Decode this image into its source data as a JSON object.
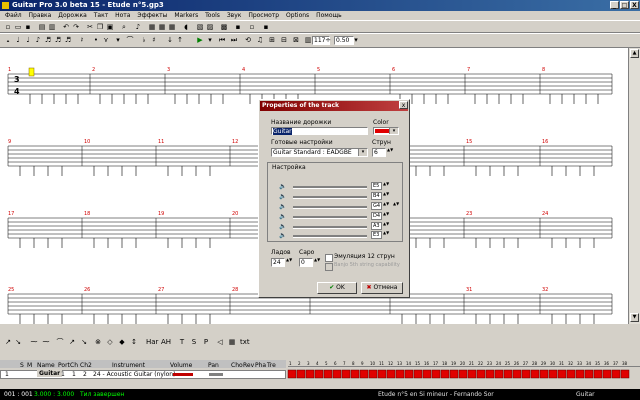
{
  "window": {
    "title": "Guitar Pro 3.0 beta 15 - Etude n°5.gp3",
    "min": "_",
    "max": "□",
    "close": "X"
  },
  "menu": [
    "Файл",
    "Правка",
    "Дорожка",
    "Такт",
    "Нота",
    "Эффекты",
    "Markers",
    "Tools",
    "Звук",
    "Просмотр",
    "Options",
    "Помощь"
  ],
  "toolbar": {
    "tempo_value": "117",
    "zoom_value": "0.50"
  },
  "score": {
    "time_sig_top": "3",
    "time_sig_bottom": "4",
    "row1_bars": [
      "1",
      "2",
      "3",
      "4",
      "5",
      "6",
      "7",
      "8"
    ],
    "row1_extra": [
      "",
      "",
      "",
      "",
      "",
      "",
      "",
      "",
      "",
      ""
    ],
    "row2_bars": [
      "9",
      "10",
      "11",
      "12",
      "13",
      "14",
      "15",
      "16"
    ],
    "row3_bars": [
      "17",
      "18",
      "19",
      "20",
      "21",
      "22",
      "23",
      "24"
    ],
    "row4_bars": [
      "25",
      "26",
      "27",
      "28",
      "29",
      "30",
      "31",
      "32"
    ],
    "right_bars": [
      "7",
      "8",
      "16",
      "24",
      "32"
    ]
  },
  "bottom_toolbar": {
    "labels": [
      "Har",
      "AH",
      "T",
      "S",
      "P"
    ],
    "txt": "txt"
  },
  "track_panel": {
    "headers": {
      "s": "S",
      "m": "M",
      "name": "Name",
      "port": "Port",
      "ch": "Ch",
      "ch2": "Ch2",
      "instrument": "Instrument",
      "volume": "Volume",
      "pan": "Pan",
      "cho": "Cho",
      "rev": "Rev",
      "pha": "Pha",
      "tre": "Tre"
    },
    "row": {
      "num": "1",
      "name": "Guitar",
      "port": "1",
      "ch": "1",
      "ch2": "2",
      "instrument": "24 - Acoustic Guitar (nylon)"
    },
    "bar_numbers": [
      "1",
      "2",
      "3",
      "4",
      "5",
      "6",
      "7",
      "8",
      "9",
      "10",
      "11",
      "12",
      "13",
      "14",
      "15",
      "16",
      "17",
      "18",
      "19",
      "20",
      "21",
      "22",
      "23",
      "24",
      "25",
      "26",
      "27",
      "28",
      "29",
      "30",
      "31",
      "32",
      "33",
      "34",
      "35",
      "36",
      "37",
      "38"
    ]
  },
  "status": {
    "pos": "001 : 001",
    "time": "3.000 : 3.000",
    "state": "Тил завершен",
    "song": "Etude n°5 en Si mineur - Fernando Sor",
    "track": "Guitar"
  },
  "dialog": {
    "title": "Properties of the track",
    "name_label": "Название дорожки",
    "name_value": "Guitar",
    "color_label": "Color",
    "preset_label": "Готовые настройки",
    "preset_value": "Guitar Standard : EADGBE",
    "strings_label": "Струн",
    "strings_value": "6",
    "tuning_label": "Настройка",
    "tunings": [
      "E5",
      "B4",
      "G4",
      "D4",
      "A3",
      "E3"
    ],
    "frets_label": "Ладов",
    "frets_value": "24",
    "capo_label": "Capo",
    "capo_value": "0",
    "emul12_label": "Эмуляция 12 струн",
    "banjo_label": "Banjo 5th string capability",
    "ok_label": "OK",
    "cancel_label": "Отмена",
    "accent_color": "#e00000"
  }
}
